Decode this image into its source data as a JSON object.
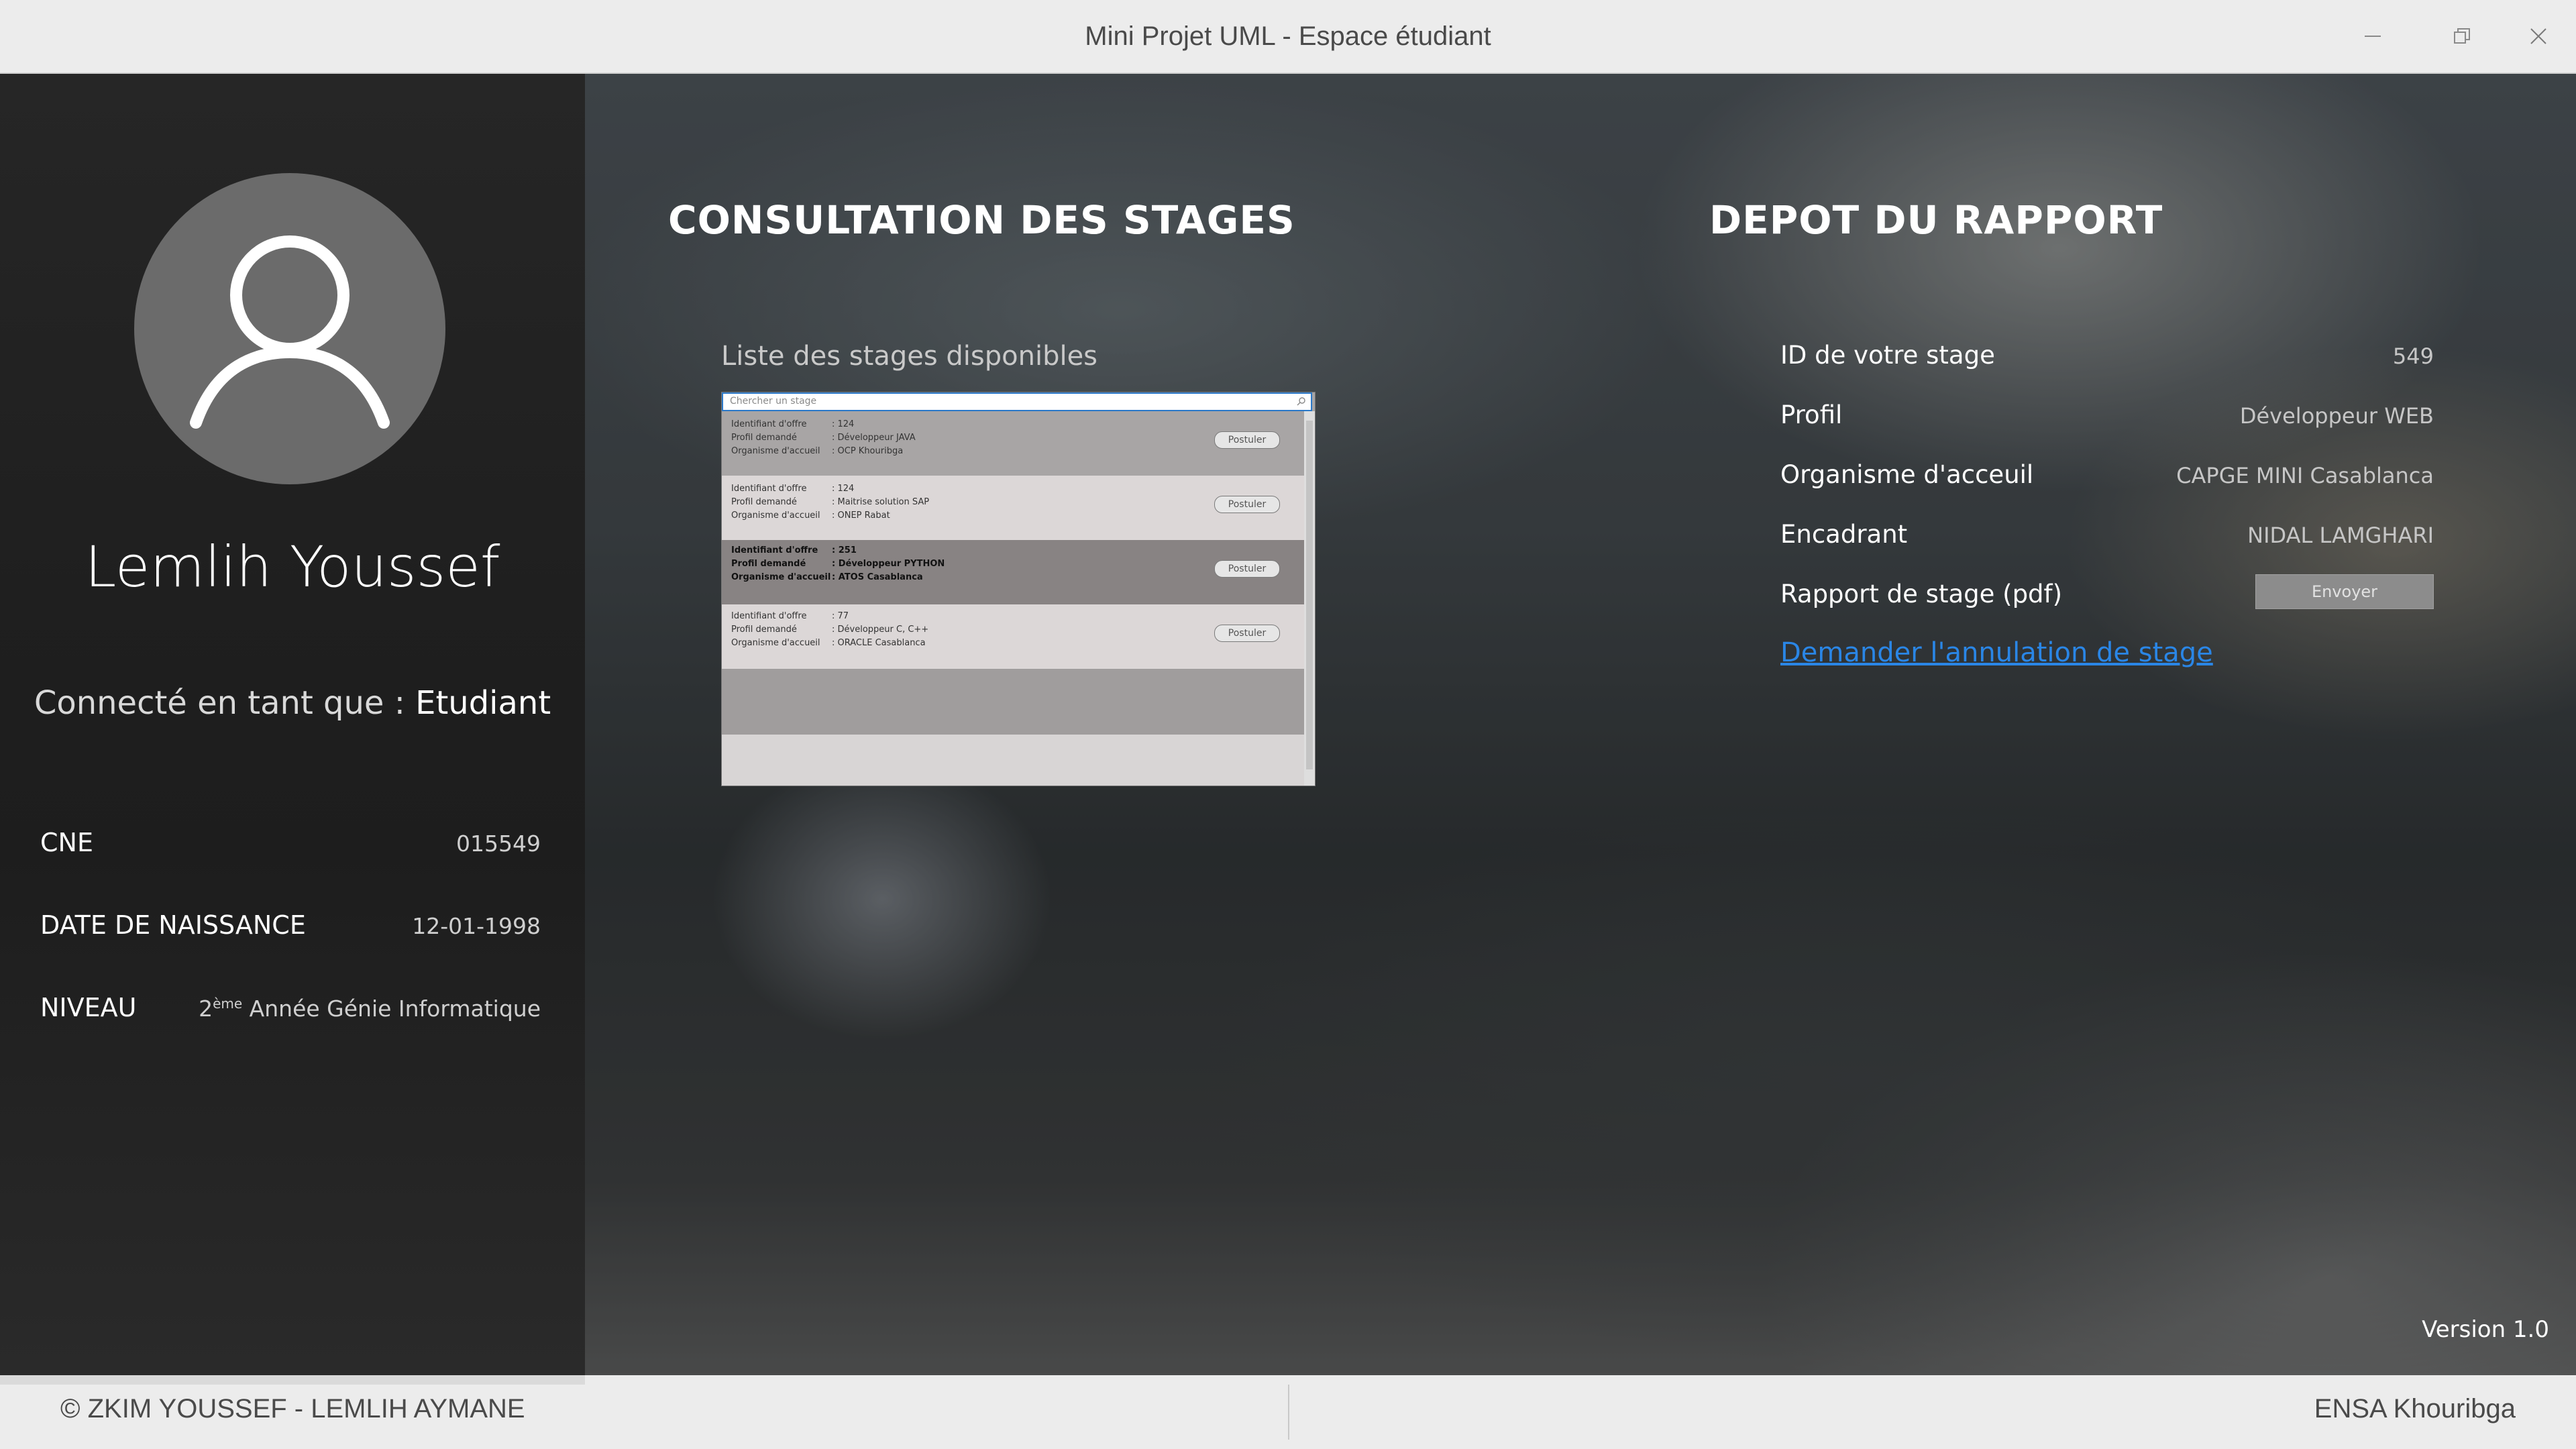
{
  "window": {
    "title": "Mini Projet UML - Espace étudiant"
  },
  "student": {
    "name": "Lemlih Youssef",
    "connected_prefix": "Connecté en tant que : ",
    "role": "Etudiant",
    "fields": [
      {
        "label": "CNE",
        "value": "015549"
      },
      {
        "label": "DATE DE NAISSANCE",
        "value": "12-01-1998"
      },
      {
        "label": "NIVEAU",
        "value_num": "2",
        "value_sup": "ème",
        "value_rest": " Année Génie Informatique"
      }
    ]
  },
  "consultation": {
    "heading": "CONSULTATION DES STAGES",
    "list_label": "Liste des stages disponibles",
    "search_placeholder": "Chercher un stage",
    "field_labels": {
      "id": "Identifiant d'offre",
      "profil": "Profil demandé",
      "org": "Organisme d'accueil"
    },
    "apply_label": "Postuler",
    "offers": [
      {
        "id": ": 124",
        "profil": ": Développeur JAVA",
        "org": ": OCP Khouribga"
      },
      {
        "id": ": 124",
        "profil": ": Maitrise solution SAP",
        "org": ": ONEP Rabat"
      },
      {
        "id": ": 251",
        "profil": ": Développeur PYTHON",
        "org": ": ATOS Casablanca"
      },
      {
        "id": ": 77",
        "profil": ": Développeur C, C++",
        "org": ": ORACLE Casablanca"
      }
    ]
  },
  "depot": {
    "heading": "DEPOT DU RAPPORT",
    "rows": [
      {
        "label": "ID de votre stage",
        "value": "549"
      },
      {
        "label": "Profil",
        "value": "Développeur WEB"
      },
      {
        "label": "Organisme d'acceuil",
        "value": "CAPGE MINI Casablanca"
      },
      {
        "label": "Encadrant",
        "value": "NIDAL LAMGHARI"
      }
    ],
    "report_label": "Rapport de stage (pdf)",
    "send_label": "Envoyer",
    "cancel_link": "Demander l'annulation de stage"
  },
  "version": "Version 1.0",
  "footer": {
    "copyright": "© ZKIM YOUSSEF - LEMLIH AYMANE",
    "school": "ENSA Khouribga"
  },
  "colors": {
    "accent": "#2a86e6",
    "titlebar": "#ececec",
    "sidebar": "#1f1f1f"
  }
}
